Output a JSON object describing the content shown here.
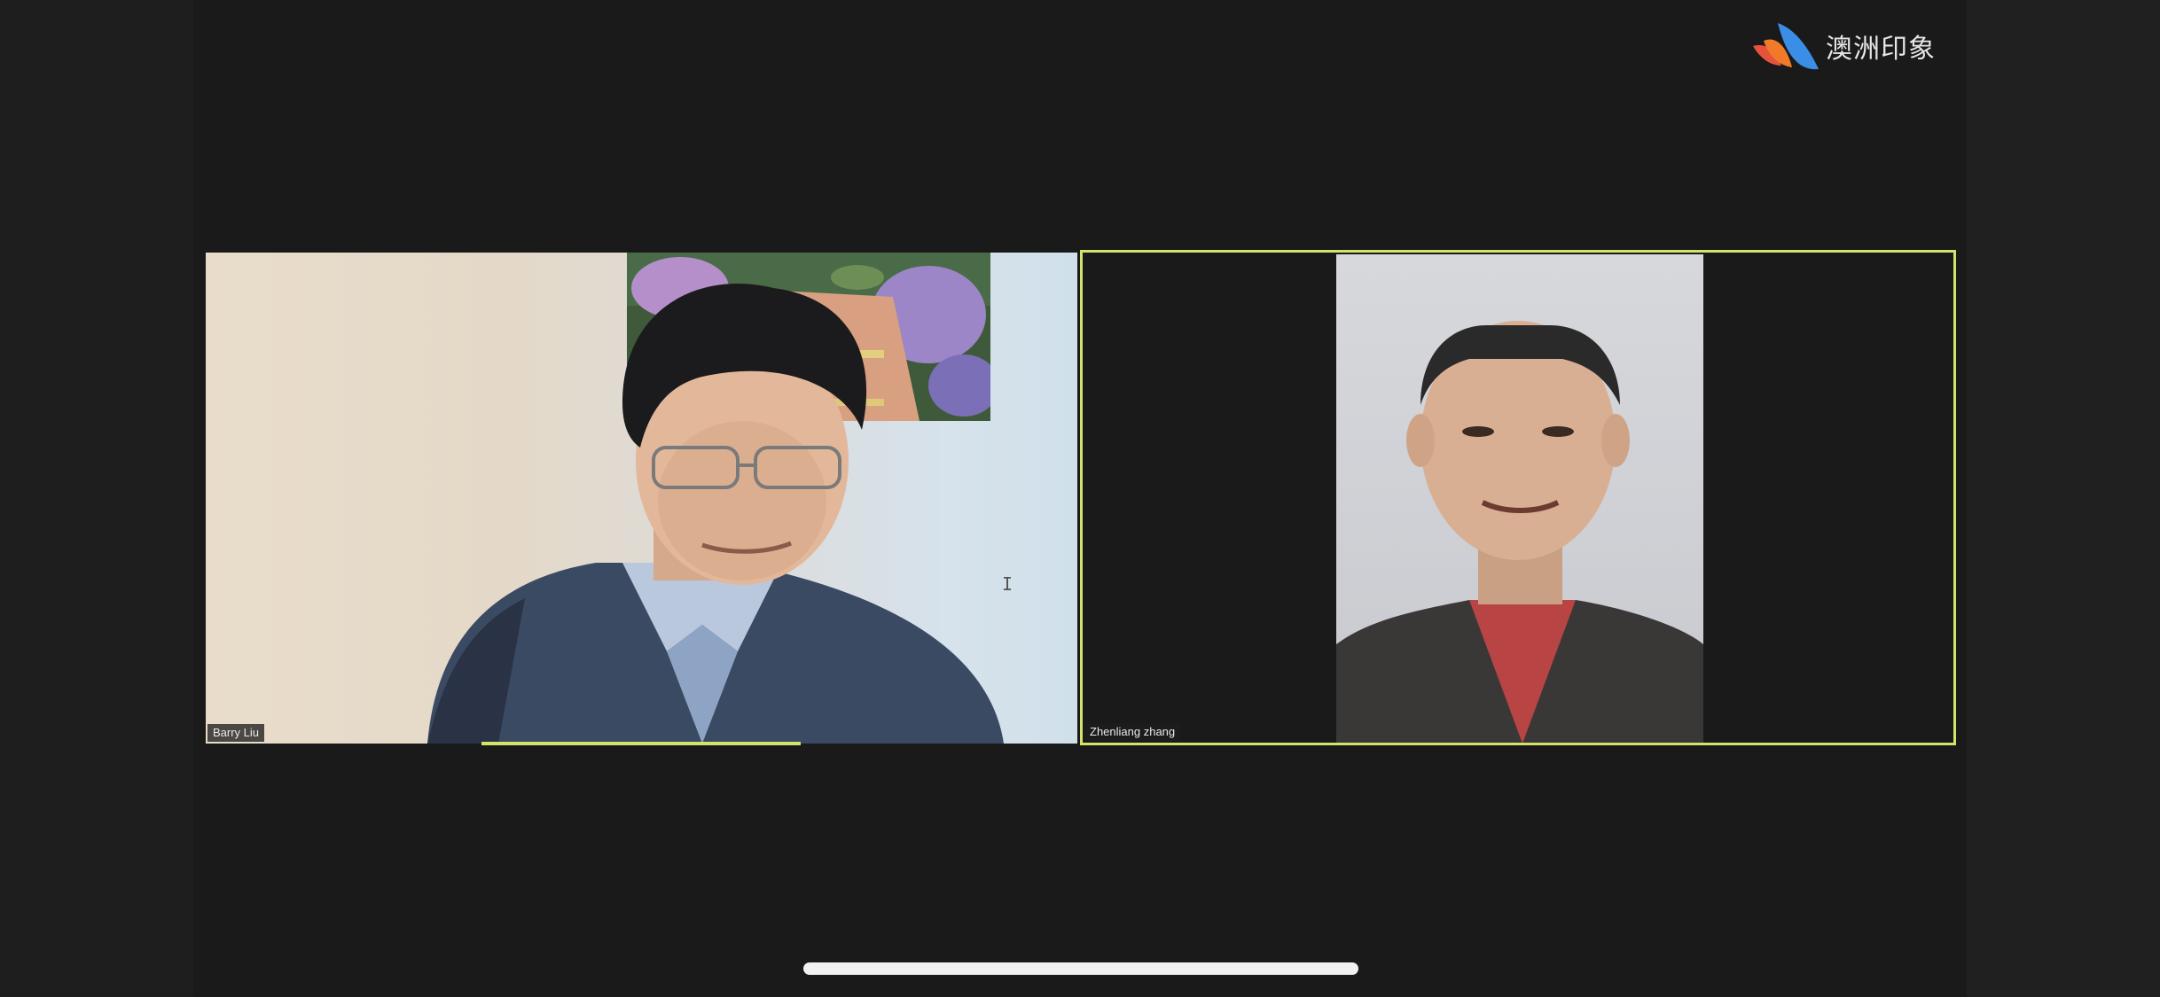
{
  "app": {
    "brand_logo_text": "澳洲印象"
  },
  "participants": [
    {
      "name": "Barry Liu",
      "active_speaker": false
    },
    {
      "name": "Zhenliang zhang",
      "active_speaker": true
    }
  ],
  "icons": {
    "logo": "brand-swoosh-icon",
    "cursor": "text-cursor-icon"
  },
  "colors": {
    "active_speaker_border": "#d3e46a",
    "background": "#1a1a1a",
    "logo_blue": "#3a8ee6",
    "logo_orange": "#f07a2a",
    "logo_red": "#e5533d"
  }
}
